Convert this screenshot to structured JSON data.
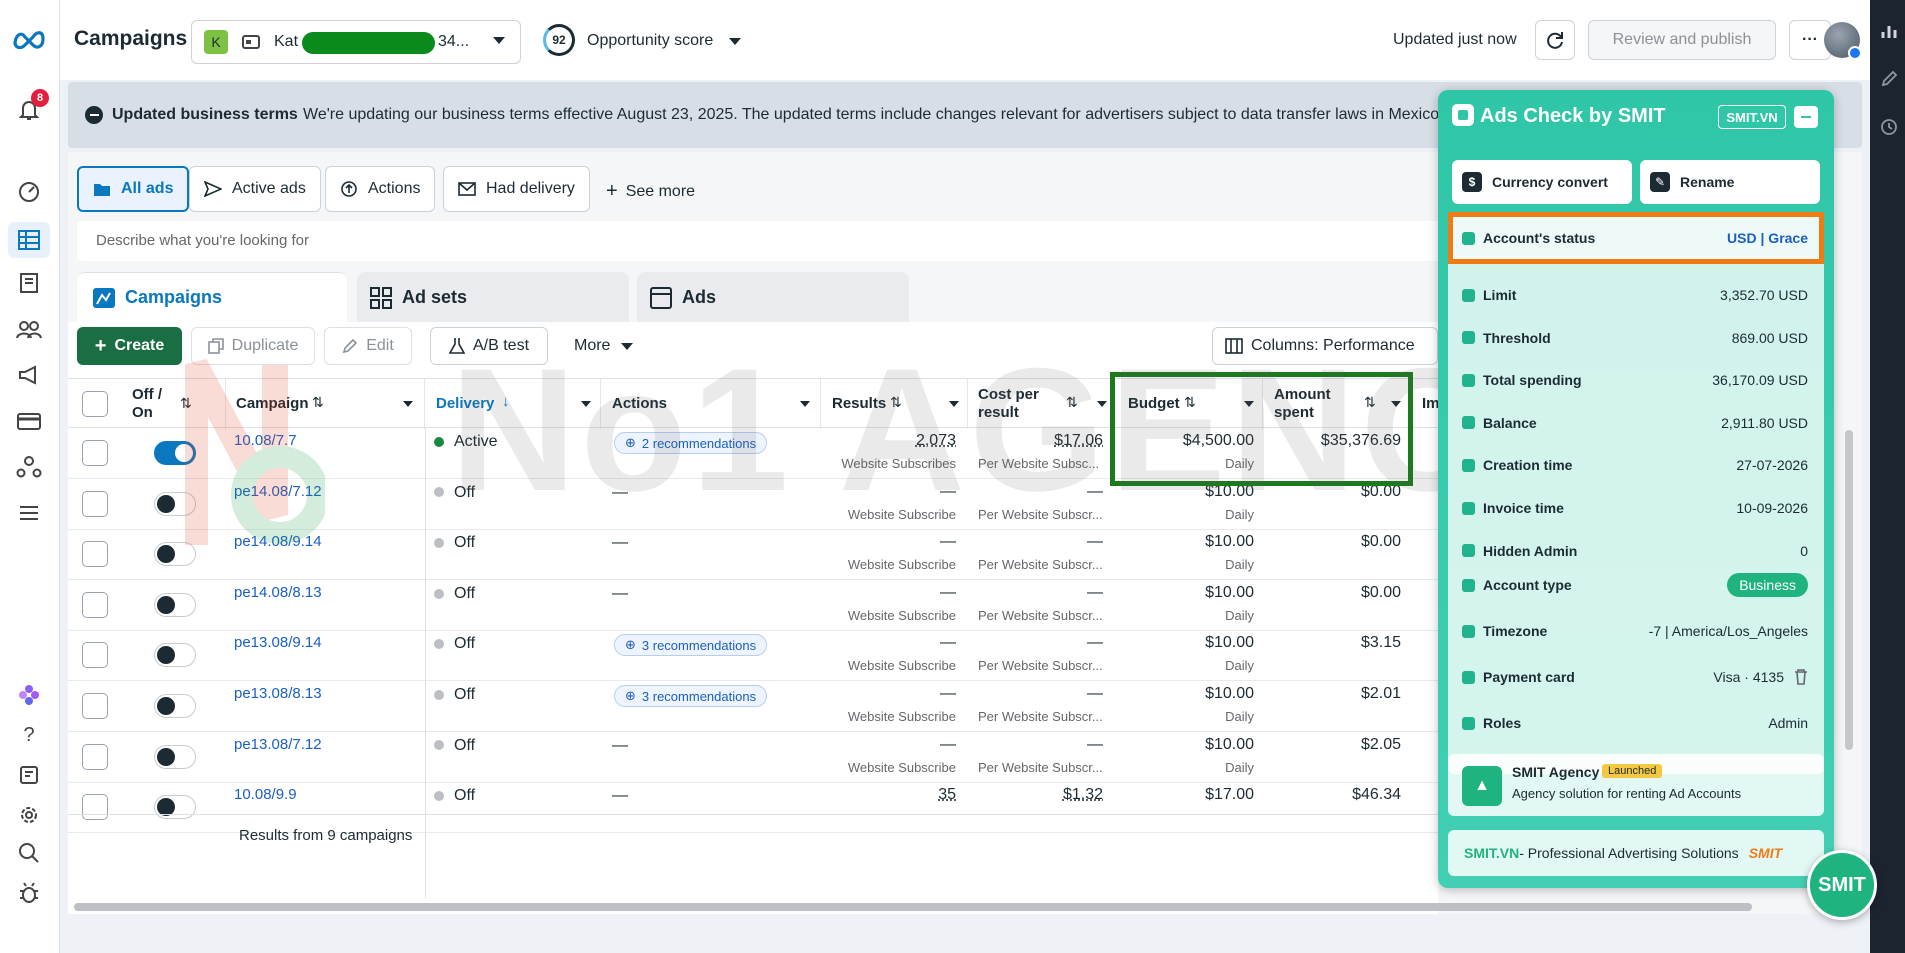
{
  "topbar": {
    "title": "Campaigns",
    "account_initial": "K",
    "account_name": "Kat",
    "account_suffix": "34...",
    "opportunity_score": "92",
    "opportunity_label": "Opportunity score",
    "updated": "Updated just now",
    "review_publish": "Review and publish",
    "more": "···"
  },
  "rail": {
    "notification_count": "8"
  },
  "banner": {
    "title": "Updated business terms",
    "text": "We're updating our business terms effective August 23, 2025. The updated terms include changes relevant for advertisers subject to data transfer laws in Mexico,"
  },
  "filters": [
    {
      "label": "All ads",
      "icon": "folder-icon"
    },
    {
      "label": "Active ads",
      "icon": "send-icon"
    },
    {
      "label": "Actions",
      "icon": "action-icon"
    },
    {
      "label": "Had delivery",
      "icon": "mail-icon"
    }
  ],
  "see_more": "See more",
  "search": {
    "placeholder": "Describe what you're looking for"
  },
  "level_tabs": [
    "Campaigns",
    "Ad sets",
    "Ads"
  ],
  "toolbar": {
    "create": "Create",
    "duplicate": "Duplicate",
    "edit": "Edit",
    "ab_test": "A/B test",
    "more": "More",
    "columns": "Columns: Performance"
  },
  "columns": {
    "off_on": "Off / On",
    "campaign": "Campaign",
    "delivery": "Delivery",
    "actions": "Actions",
    "results": "Results",
    "cost_per_result": "Cost per result",
    "budget": "Budget",
    "amount_spent": "Amount spent",
    "truncated": "Im"
  },
  "rows": [
    {
      "name": "10.08/7.7",
      "on": true,
      "delivery": "Active",
      "status_color": "#1b8a3c",
      "actions": "2 recommendations",
      "results": "2,073",
      "results_sub": "Website Subscribes",
      "cpr": "$17.06",
      "cpr_sub": "Per Website Subsc...",
      "budget": "$4,500.00",
      "budget_sub": "Daily",
      "spent": "$35,376.69"
    },
    {
      "name": "pe14.08/7.12",
      "on": false,
      "delivery": "Off",
      "status_color": "#bcc0c4",
      "actions": "—",
      "results": "—",
      "results_sub": "Website Subscribe",
      "cpr": "—",
      "cpr_sub": "Per Website Subscr...",
      "budget": "$10.00",
      "budget_sub": "Daily",
      "spent": "$0.00"
    },
    {
      "name": "pe14.08/9.14",
      "on": false,
      "delivery": "Off",
      "status_color": "#bcc0c4",
      "actions": "—",
      "results": "—",
      "results_sub": "Website Subscribe",
      "cpr": "—",
      "cpr_sub": "Per Website Subscr...",
      "budget": "$10.00",
      "budget_sub": "Daily",
      "spent": "$0.00"
    },
    {
      "name": "pe14.08/8.13",
      "on": false,
      "delivery": "Off",
      "status_color": "#bcc0c4",
      "actions": "—",
      "results": "—",
      "results_sub": "Website Subscribe",
      "cpr": "—",
      "cpr_sub": "Per Website Subscr...",
      "budget": "$10.00",
      "budget_sub": "Daily",
      "spent": "$0.00"
    },
    {
      "name": "pe13.08/9.14",
      "on": false,
      "delivery": "Off",
      "status_color": "#bcc0c4",
      "actions": "3 recommendations",
      "results": "—",
      "results_sub": "Website Subscribe",
      "cpr": "—",
      "cpr_sub": "Per Website Subscr...",
      "budget": "$10.00",
      "budget_sub": "Daily",
      "spent": "$3.15"
    },
    {
      "name": "pe13.08/8.13",
      "on": false,
      "delivery": "Off",
      "status_color": "#bcc0c4",
      "actions": "3 recommendations",
      "results": "—",
      "results_sub": "Website Subscribe",
      "cpr": "—",
      "cpr_sub": "Per Website Subscr...",
      "budget": "$10.00",
      "budget_sub": "Daily",
      "spent": "$2.01"
    },
    {
      "name": "pe13.08/7.12",
      "on": false,
      "delivery": "Off",
      "status_color": "#bcc0c4",
      "actions": "—",
      "results": "—",
      "results_sub": "Website Subscribe",
      "cpr": "—",
      "cpr_sub": "Per Website Subscr...",
      "budget": "$10.00",
      "budget_sub": "Daily",
      "spent": "$2.05"
    },
    {
      "name": "10.08/9.9",
      "on": false,
      "delivery": "Off",
      "status_color": "#bcc0c4",
      "actions": "—",
      "results": "35",
      "results_sub": "",
      "cpr": "$1.32",
      "cpr_sub": "",
      "budget": "$17.00",
      "budget_sub": "",
      "spent": "$46.34"
    }
  ],
  "footer": "Results from 9 campaigns",
  "watermark": "No1 AGENCY",
  "smit": {
    "title": "Ads Check by SMIT",
    "badge": "SMIT.VN",
    "currency_convert": "Currency convert",
    "rename": "Rename",
    "status_label": "Account's status",
    "status_value": "USD | Grace",
    "items": [
      {
        "label": "Limit",
        "value": "3,352.70 USD"
      },
      {
        "label": "Threshold",
        "value": "869.00 USD"
      },
      {
        "label": "Total spending",
        "value": "36,170.09 USD"
      },
      {
        "label": "Balance",
        "value": "2,911.80 USD"
      },
      {
        "label": "Creation time",
        "value": "27-07-2026"
      },
      {
        "label": "Invoice time",
        "value": "10-09-2026"
      },
      {
        "label": "Hidden Admin",
        "value": "0"
      }
    ],
    "account_type_label": "Account type",
    "account_type_value": "Business",
    "timezone_label": "Timezone",
    "timezone_value": "-7 | America/Los_Angeles",
    "payment_label": "Payment card",
    "payment_value": "Visa · 4135",
    "roles_label": "Roles",
    "roles_value": "Admin",
    "agency_title": "SMIT Agency",
    "agency_badge": "Launched",
    "agency_desc": "Agency solution for renting Ad Accounts",
    "footer_brand": "SMIT.VN",
    "footer_text": " - Professional Advertising Solutions",
    "footer_logo": "SMIT",
    "fab": "SMIT"
  },
  "colors": {
    "accent": "#0a78be",
    "create": "#1a6e43",
    "budget_box": "#1b7a1b",
    "status_box": "#f07a14",
    "smit": "#2fc6a8"
  }
}
